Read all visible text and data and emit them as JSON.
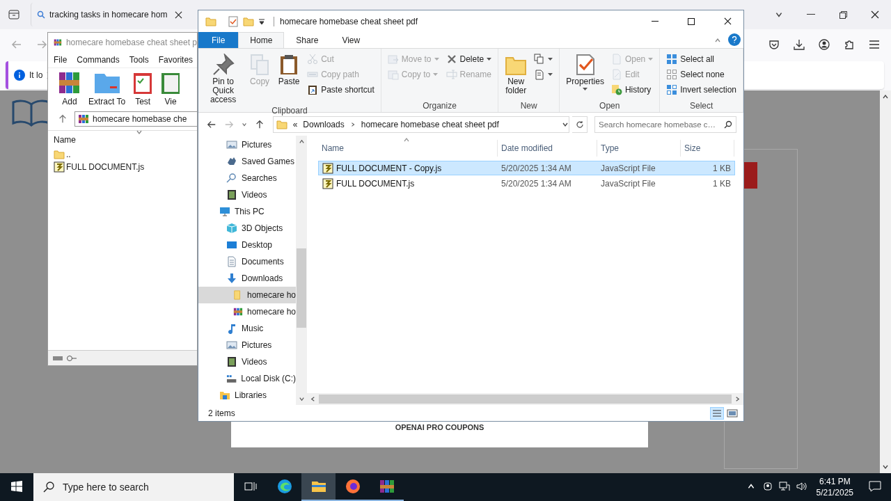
{
  "browser": {
    "tabs": [
      {
        "title": "tracking tasks in homecare hom"
      }
    ],
    "notification": {
      "text": "It lo"
    },
    "page": {
      "heading": "OPENAI PRO COUPONS"
    }
  },
  "winrar": {
    "title": "homecare homebase cheat sheet p",
    "menu": [
      "File",
      "Commands",
      "Tools",
      "Favorites"
    ],
    "toolbar": [
      "Add",
      "Extract To",
      "Test",
      "Vie"
    ],
    "path": "homecare homebase che",
    "column": "Name",
    "files": [
      {
        "name": "..",
        "kind": "parent"
      },
      {
        "name": "FULL DOCUMENT.js",
        "kind": "script"
      }
    ]
  },
  "explorer": {
    "title": "homecare homebase cheat sheet pdf",
    "ribbon_tabs": [
      {
        "label": "File",
        "kind": "file",
        "selected": false
      },
      {
        "label": "Home",
        "kind": "tab",
        "selected": true
      },
      {
        "label": "Share",
        "kind": "tab",
        "selected": false
      },
      {
        "label": "View",
        "kind": "tab",
        "selected": false
      }
    ],
    "ribbon_groups": [
      {
        "label": "Clipboard",
        "columns": [
          {
            "kind": "large",
            "items": [
              {
                "label": "Pin to Quick\naccess",
                "disabled": false,
                "dropdown": false
              }
            ]
          },
          {
            "kind": "large",
            "items": [
              {
                "label": "Copy",
                "disabled": true,
                "dropdown": false
              }
            ]
          },
          {
            "kind": "large",
            "items": [
              {
                "label": "Paste",
                "disabled": false,
                "dropdown": false
              }
            ]
          },
          {
            "kind": "small",
            "items": [
              {
                "label": "Cut",
                "disabled": true,
                "dropdown": false
              },
              {
                "label": "Copy path",
                "disabled": true,
                "dropdown": false
              },
              {
                "label": "Paste shortcut",
                "disabled": false,
                "dropdown": false
              }
            ]
          }
        ]
      },
      {
        "label": "Organize",
        "columns": [
          {
            "kind": "small",
            "items": [
              {
                "label": "Move to",
                "disabled": true,
                "dropdown": true
              },
              {
                "label": "Copy to",
                "disabled": true,
                "dropdown": true
              }
            ]
          },
          {
            "kind": "small",
            "items": [
              {
                "label": "Delete",
                "disabled": false,
                "dropdown": true
              },
              {
                "label": "Rename",
                "disabled": true,
                "dropdown": false
              }
            ]
          }
        ]
      },
      {
        "label": "New",
        "columns": [
          {
            "kind": "large",
            "items": [
              {
                "label": "New\nfolder",
                "disabled": false,
                "dropdown": false
              }
            ]
          },
          {
            "kind": "small",
            "items": [
              {
                "disabled": false,
                "dropdown": true
              },
              {
                "disabled": false,
                "dropdown": true
              }
            ]
          }
        ]
      },
      {
        "label": "Open",
        "columns": [
          {
            "kind": "large",
            "items": [
              {
                "label": "Properties",
                "disabled": false,
                "dropdown": true
              }
            ]
          },
          {
            "kind": "small",
            "items": [
              {
                "label": "Open",
                "disabled": true,
                "dropdown": true
              },
              {
                "label": "Edit",
                "disabled": true,
                "dropdown": false
              },
              {
                "label": "History",
                "disabled": false,
                "dropdown": false
              }
            ]
          }
        ]
      },
      {
        "label": "Select",
        "columns": [
          {
            "kind": "small",
            "items": [
              {
                "label": "Select all",
                "disabled": false,
                "dropdown": false
              },
              {
                "label": "Select none",
                "disabled": false,
                "dropdown": false
              },
              {
                "label": "Invert selection",
                "disabled": false,
                "dropdown": false
              }
            ]
          }
        ]
      }
    ],
    "address": {
      "overflow": "«",
      "crumbs": [
        "Downloads",
        "homecare homebase cheat sheet pdf"
      ]
    },
    "search": {
      "placeholder": "Search homecare homebase c…"
    },
    "nav": {
      "continued": [
        {
          "label": "Pictures",
          "selected": false
        },
        {
          "label": "Saved Games",
          "selected": false
        },
        {
          "label": "Searches",
          "selected": false
        },
        {
          "label": "Videos",
          "selected": false
        }
      ],
      "tree": [
        {
          "label": "This PC",
          "selected": false,
          "children": [
            {
              "label": "3D Objects",
              "selected": false
            },
            {
              "label": "Desktop",
              "selected": false
            },
            {
              "label": "Documents",
              "selected": false
            },
            {
              "label": "Downloads",
              "selected": false,
              "children": [
                {
                  "label": "homecare ho",
                  "selected": true
                },
                {
                  "label": "homecare ho",
                  "selected": false
                }
              ]
            },
            {
              "label": "Music",
              "selected": false
            },
            {
              "label": "Pictures",
              "selected": false
            },
            {
              "label": "Videos",
              "selected": false
            },
            {
              "label": "Local Disk (C:)",
              "selected": false
            }
          ]
        },
        {
          "label": "Libraries",
          "selected": false
        }
      ]
    },
    "columns": [
      "Name",
      "Date modified",
      "Type",
      "Size"
    ],
    "files": [
      {
        "name": "FULL DOCUMENT - Copy.js",
        "date": "5/20/2025 1:34 AM",
        "type": "JavaScript File",
        "size": "1 KB",
        "selected": true
      },
      {
        "name": "FULL DOCUMENT.js",
        "date": "5/20/2025 1:34 AM",
        "type": "JavaScript File",
        "size": "1 KB",
        "selected": false
      }
    ],
    "status": "2 items"
  },
  "taskbar": {
    "search_placeholder": "Type here to search",
    "apps": [
      {
        "active": false,
        "running": false
      },
      {
        "active": true,
        "running": true
      },
      {
        "active": false,
        "running": true
      },
      {
        "active": false,
        "running": true
      }
    ],
    "time": "6:41 PM",
    "date": "5/21/2025"
  }
}
